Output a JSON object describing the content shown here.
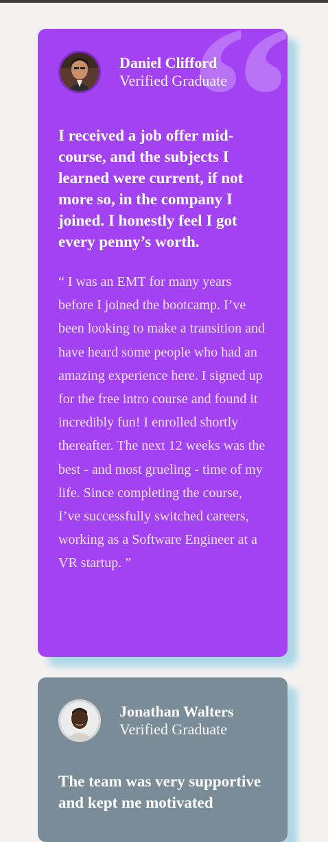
{
  "colors": {
    "card1_bg": "#a242f3",
    "card2_bg": "#7a8c98",
    "page_bg": "#f3f2f1"
  },
  "testimonials": [
    {
      "name": "Daniel Clifford",
      "role": "Verified Graduate",
      "headline": "I received a job offer mid-course, and the subjects I learned were current, if not more so, in the company I joined. I honestly feel I got every penny’s worth.",
      "quote": "“ I was an EMT for many years before I joined the bootcamp. I’ve been looking to make a transition and have heard some people who had an amazing experience here. I signed up for the free intro course and found it incredibly fun! I enrolled shortly thereafter. The next 12 weeks was the best - and most grueling - time of my life. Since completing the course, I’ve successfully switched careers, working as a Software Engineer at a VR startup. ”",
      "avatar_icon": "avatar-photo"
    },
    {
      "name": "Jonathan Walters",
      "role": "Verified Graduate",
      "headline": "The team was very supportive and kept me motivated",
      "avatar_icon": "avatar-photo"
    }
  ],
  "decor": {
    "quote_glyph": "“",
    "quote_icon": "quote-mark-icon"
  }
}
